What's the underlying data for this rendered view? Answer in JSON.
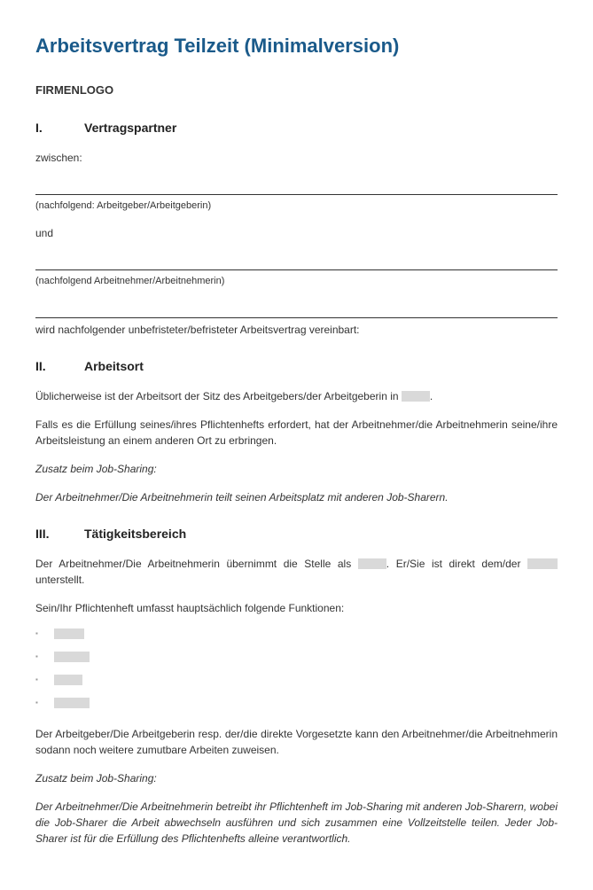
{
  "title": "Arbeitsvertrag Teilzeit (Minimalversion)",
  "logo": "FIRMENLOGO",
  "s1": {
    "num": "I.",
    "heading": "Vertragspartner",
    "between": "zwischen:",
    "employer_note": "(nachfolgend: Arbeitgeber/Arbeitgeberin)",
    "and": "und",
    "employee_note": "(nachfolgend Arbeitnehmer/Arbeitnehmerin)",
    "agreed": "wird nachfolgender unbefristeter/befristeter Arbeitsvertrag vereinbart:"
  },
  "s2": {
    "num": "II.",
    "heading": "Arbeitsort",
    "p1a": "Üblicherweise ist der Arbeitsort der Sitz des Arbeitgebers/der Arbeitgeberin in ",
    "p1b": ".",
    "p2": "Falls es die Erfüllung seines/ihres Pflichtenhefts erfordert, hat der Arbeitnehmer/die Arbeitnehmerin seine/ihre Arbeitsleistung an einem anderen Ort zu erbringen.",
    "addendum_label": "Zusatz beim Job-Sharing:",
    "addendum_text": "Der Arbeitnehmer/Die Arbeitnehmerin teilt seinen Arbeitsplatz mit anderen Job-Sharern."
  },
  "s3": {
    "num": "III.",
    "heading": "Tätigkeitsbereich",
    "p1a": "Der Arbeitnehmer/Die Arbeitnehmerin übernimmt die Stelle als ",
    "p1b": ". Er/Sie ist direkt dem/der ",
    "p1c": " unterstellt.",
    "p2": "Sein/Ihr Pflichtenheft umfasst hauptsächlich folgende Funktionen:",
    "p3": "Der Arbeitgeber/Die Arbeitgeberin resp. der/die direkte Vorgesetzte kann den Arbeitnehmer/die Arbeitnehmerin sodann noch weitere zumutbare Arbeiten zuweisen.",
    "addendum_label": "Zusatz beim Job-Sharing:",
    "addendum_text": "Der Arbeitnehmer/Die Arbeitnehmerin betreibt ihr Pflichtenheft im Job-Sharing mit anderen Job-Sharern, wobei die Job-Sharer die Arbeit abwechseln ausführen und sich zusammen eine Vollzeitstelle teilen. Jeder Job-Sharer ist für die Erfüllung des Pflichtenhefts alleine verantwortlich."
  }
}
